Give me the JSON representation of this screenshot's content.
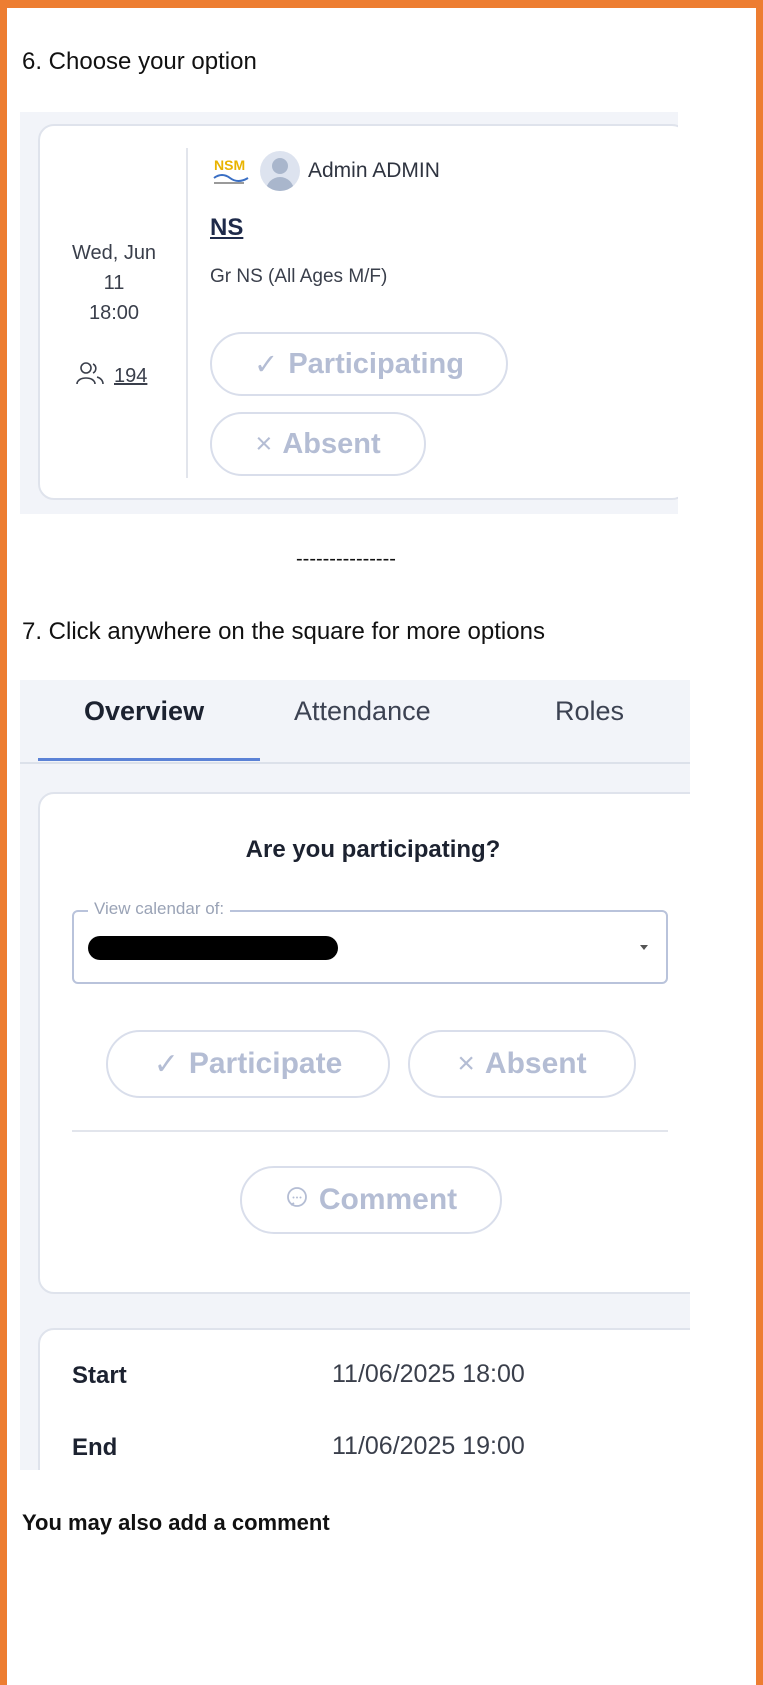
{
  "step6": {
    "label": "6. Choose your option"
  },
  "shot1": {
    "date": {
      "weekday_month": "Wed, Jun",
      "day": "11",
      "time": "18:00"
    },
    "participants_count": "194",
    "organizer": {
      "name": "Admin ADMIN",
      "logo_text": "NSM"
    },
    "event": {
      "title": "NS",
      "subtitle": "Gr NS (All Ages M/F)"
    },
    "buttons": {
      "participating": {
        "icon": "✓",
        "label": "Participating"
      },
      "absent": {
        "icon": "×",
        "label": "Absent"
      }
    }
  },
  "separator": "---------------",
  "step7": {
    "label": "7. Click anywhere on the square for more options"
  },
  "shot2": {
    "tabs": [
      {
        "label": "Overview",
        "active": true
      },
      {
        "label": "Attendance",
        "active": false
      },
      {
        "label": "Roles",
        "active": false
      }
    ],
    "question": "Are you participating?",
    "calendar_select": {
      "legend": "View calendar of:",
      "value_redacted": true
    },
    "buttons": {
      "participate": {
        "icon": "✓",
        "label": "Participate"
      },
      "absent": {
        "icon": "×",
        "label": "Absent"
      },
      "comment": {
        "icon": "comment-icon",
        "label": "Comment"
      }
    },
    "details": [
      {
        "label": "Start",
        "value": "11/06/2025 18:00"
      },
      {
        "label": "End",
        "value": "11/06/2025 19:00"
      }
    ]
  },
  "footer_note": "You may also add a comment",
  "colors": {
    "frame": "#ED7D31",
    "tab_accent": "#5b82d6",
    "pill_text": "#b4bdd4"
  }
}
